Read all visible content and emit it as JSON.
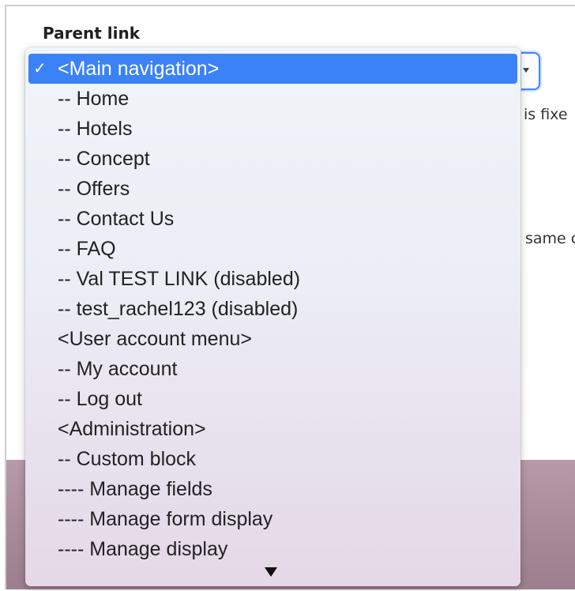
{
  "field": {
    "label": "Parent link"
  },
  "background_text": {
    "line1": "is fixe",
    "line2": "same c"
  },
  "dropdown": {
    "check_glyph": "✓",
    "items": [
      {
        "label": "<Main navigation>",
        "selected": true
      },
      {
        "label": "-- Home"
      },
      {
        "label": "-- Hotels"
      },
      {
        "label": "-- Concept"
      },
      {
        "label": "-- Offers"
      },
      {
        "label": "-- Contact Us"
      },
      {
        "label": "-- FAQ"
      },
      {
        "label": "-- Val TEST LINK (disabled)"
      },
      {
        "label": "-- test_rachel123 (disabled)"
      },
      {
        "label": "<User account menu>"
      },
      {
        "label": "-- My account"
      },
      {
        "label": "-- Log out"
      },
      {
        "label": "<Administration>"
      },
      {
        "label": "-- Custom block"
      },
      {
        "label": "---- Manage fields"
      },
      {
        "label": "---- Manage form display"
      },
      {
        "label": "---- Manage display"
      }
    ],
    "scroll_indicator_icon": "triangle-down"
  },
  "colors": {
    "selection": "#3b82f6",
    "focus_ring": "#3f86f5"
  }
}
